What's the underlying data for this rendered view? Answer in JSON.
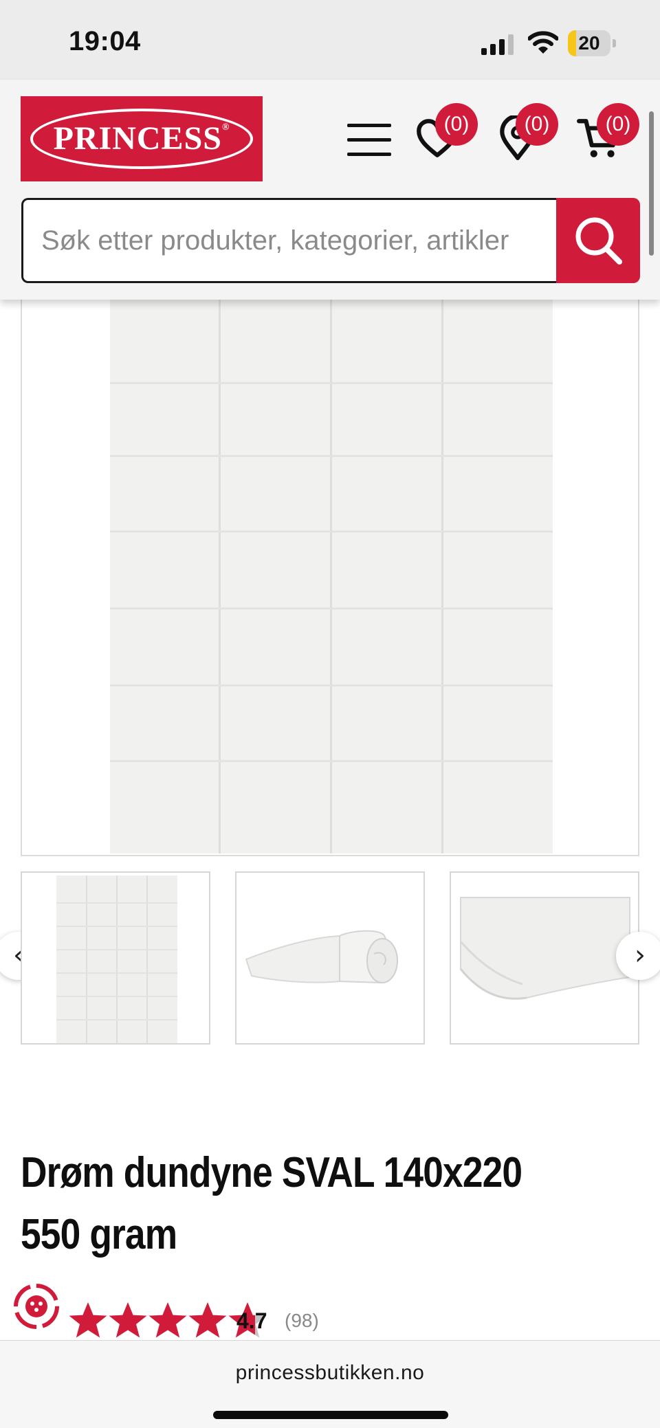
{
  "status_bar": {
    "time": "19:04",
    "battery_level": "20",
    "battery_fraction": 0.2
  },
  "header": {
    "logo_text": "PRINCESS",
    "logo_mark": "®",
    "wishlist_count": "(0)",
    "stores_count": "(0)",
    "cart_count": "(0)"
  },
  "search": {
    "placeholder": "Søk etter produkter, kategorier, artikler"
  },
  "gallery": {
    "prev_label": "‹",
    "next_label": "›"
  },
  "product": {
    "title": "Drøm dundyne SVAL 140x220 550 gram",
    "rating_value": "4.7",
    "rating_count": "(98)",
    "rating_stars": 4.7
  },
  "browser": {
    "url": "princessbutikken.no"
  },
  "colors": {
    "brand": "#d01c3a",
    "star_gray": "#c4c4c4"
  }
}
